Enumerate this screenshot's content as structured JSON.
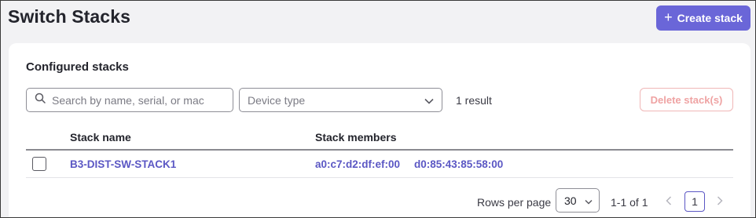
{
  "header": {
    "title": "Switch Stacks",
    "create_label": "Create stack",
    "create_icon": "plus-icon"
  },
  "card": {
    "title": "Configured stacks",
    "search_placeholder": "Search by name, serial, or mac",
    "device_type_placeholder": "Device type",
    "result_count": "1 result",
    "delete_label": "Delete stack(s)"
  },
  "table": {
    "columns": [
      "Stack name",
      "Stack members"
    ],
    "rows": [
      {
        "checked": false,
        "stack_name": "B3-DIST-SW-STACK1",
        "members": [
          "a0:c7:d2:df:ef:00",
          "d0:85:43:85:58:00"
        ]
      }
    ]
  },
  "pagination": {
    "rows_per_page_label": "Rows per page",
    "rows_per_page": "30",
    "range": "1-1 of 1",
    "current_page": "1"
  },
  "colors": {
    "accent": "#6a66d8",
    "link": "#5b57c4",
    "danger_disabled": "#efa3a3"
  }
}
